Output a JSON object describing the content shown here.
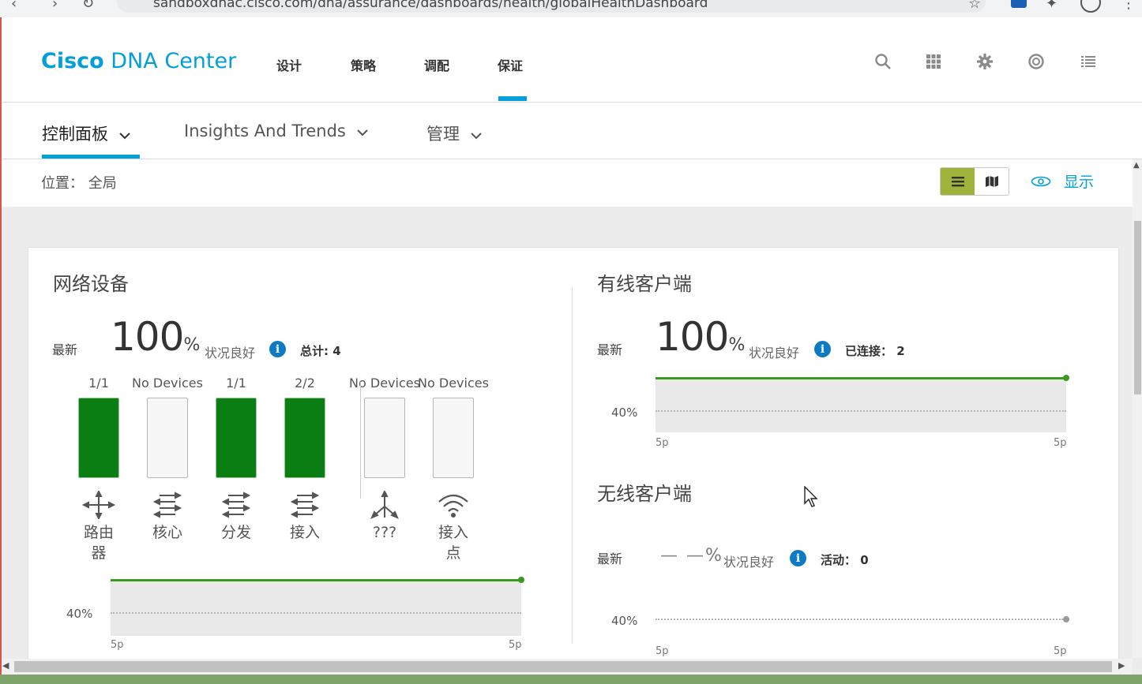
{
  "browser": {
    "url": "sandboxdnac.cisco.com/dna/assurance/dashboards/health/globalHealthDashboard"
  },
  "header": {
    "brand_bold": "Cisco",
    "brand_rest": "DNA Center",
    "nav": [
      "设计",
      "策略",
      "调配",
      "保证"
    ],
    "active_nav": "保证",
    "icons": [
      "search-icon",
      "apps-grid-icon",
      "gear-icon",
      "globe-icon",
      "list-icon"
    ]
  },
  "subnav": {
    "tabs": [
      "控制面板",
      "Insights And Trends",
      "管理"
    ],
    "active": "控制面板"
  },
  "location": {
    "label": "位置： 全局",
    "show_label": "显示"
  },
  "network_devices": {
    "title": "网络设备",
    "latest_label": "最新",
    "score": "100",
    "pct": "%",
    "healthy_label": "状况良好",
    "total_label": "总计: 4",
    "devices": [
      {
        "ratio": "1/1",
        "name": "路由\n器",
        "fill": 1.0,
        "icon": "router-icon"
      },
      {
        "ratio": "No Devices",
        "name": "核心",
        "fill": 0,
        "icon": "core-switch-icon"
      },
      {
        "ratio": "1/1",
        "name": "分发",
        "fill": 1.0,
        "icon": "distribution-switch-icon"
      },
      {
        "ratio": "2/2",
        "name": "接入",
        "fill": 1.0,
        "icon": "access-switch-icon"
      },
      {
        "ratio": "No Devices",
        "name": "???",
        "fill": 0,
        "icon": "unknown-device-icon"
      },
      {
        "ratio": "No Devices",
        "name": "接入\n点",
        "fill": 0,
        "icon": "access-point-icon"
      }
    ],
    "chart": {
      "threshold": "40%",
      "x_start": "5p",
      "x_end": "5p"
    }
  },
  "wired_clients": {
    "title": "有线客户端",
    "latest_label": "最新",
    "score": "100",
    "pct": "%",
    "healthy_label": "状况良好",
    "connected_label": "已连接： 2",
    "chart": {
      "threshold": "40%",
      "x_start": "5p",
      "x_end": "5p"
    }
  },
  "wireless_clients": {
    "title": "无线客户端",
    "latest_label": "最新",
    "score": "— —",
    "pct": "%",
    "healthy_label": "状况良好",
    "active_label": "活动： 0",
    "chart": {
      "threshold": "40%",
      "x_start": "5p",
      "x_end": "5p"
    }
  },
  "colors": {
    "accent": "#049fd9",
    "healthy_green": "#0a7d13",
    "toggle_active": "#9fb23a",
    "info_blue": "#0d7bc4"
  }
}
